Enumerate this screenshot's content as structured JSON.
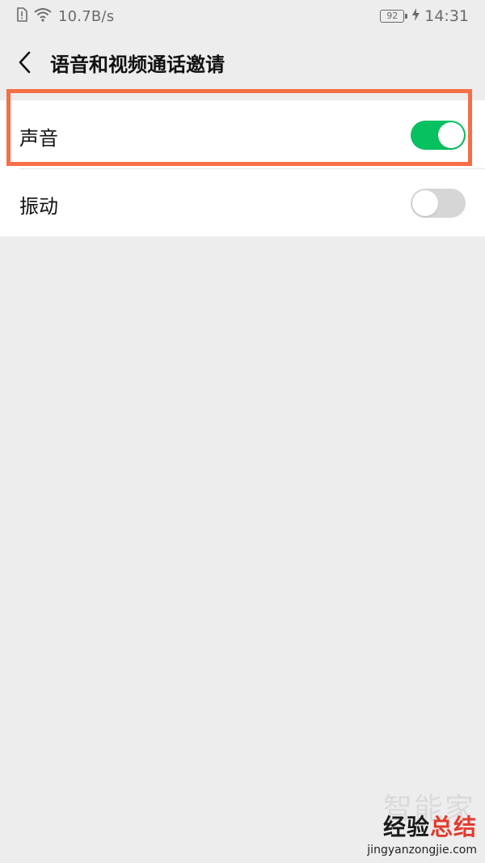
{
  "status_bar": {
    "net_speed": "10.7B/s",
    "battery": "92",
    "time": "14:31",
    "icons": [
      "sim-alert-icon",
      "wifi-icon",
      "battery-icon",
      "charging-icon"
    ]
  },
  "header": {
    "title": "语音和视频通话邀请",
    "back_icon": "chevron-left-icon"
  },
  "settings": {
    "items": [
      {
        "label": "声音",
        "enabled": true
      },
      {
        "label": "振动",
        "enabled": false
      }
    ]
  },
  "colors": {
    "accent": "#07c160",
    "highlight": "#f56f45",
    "background": "#ededed",
    "toggle_off": "#d6d6d6"
  },
  "watermark": {
    "faint": "智能家",
    "main_a": "经验",
    "main_b": "总结",
    "url": "jingyanzongjie.com"
  }
}
